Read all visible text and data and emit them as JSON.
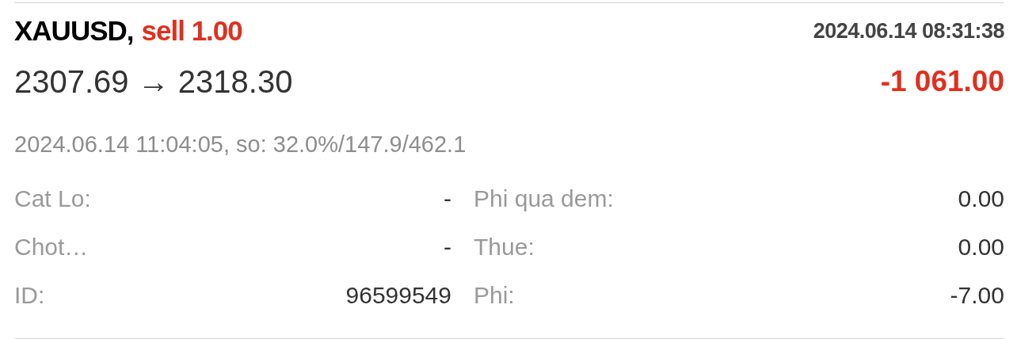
{
  "trade": {
    "symbol": "XAUUSD,",
    "side": {
      "text": "sell 1.00",
      "kind": "sell"
    },
    "open_time": "2024.06.14 08:31:38",
    "open_price": "2307.69",
    "arrow": "→",
    "close_price": "2318.30",
    "profit": {
      "text": "-1 061.00",
      "kind": "loss"
    },
    "close_info": "2024.06.14 11:04:05, so: 32.0%/147.9/462.1"
  },
  "rows": [
    {
      "left": {
        "label": "Cat Lo:",
        "value": "-"
      },
      "right": {
        "label": "Phi qua dem:",
        "value": "0.00"
      }
    },
    {
      "left": {
        "label": "Chot…",
        "value": "-"
      },
      "right": {
        "label": "Thue:",
        "value": "0.00"
      }
    },
    {
      "left": {
        "label": "ID:",
        "value": "96599549"
      },
      "right": {
        "label": "Phi:",
        "value": "-7.00"
      }
    }
  ]
}
